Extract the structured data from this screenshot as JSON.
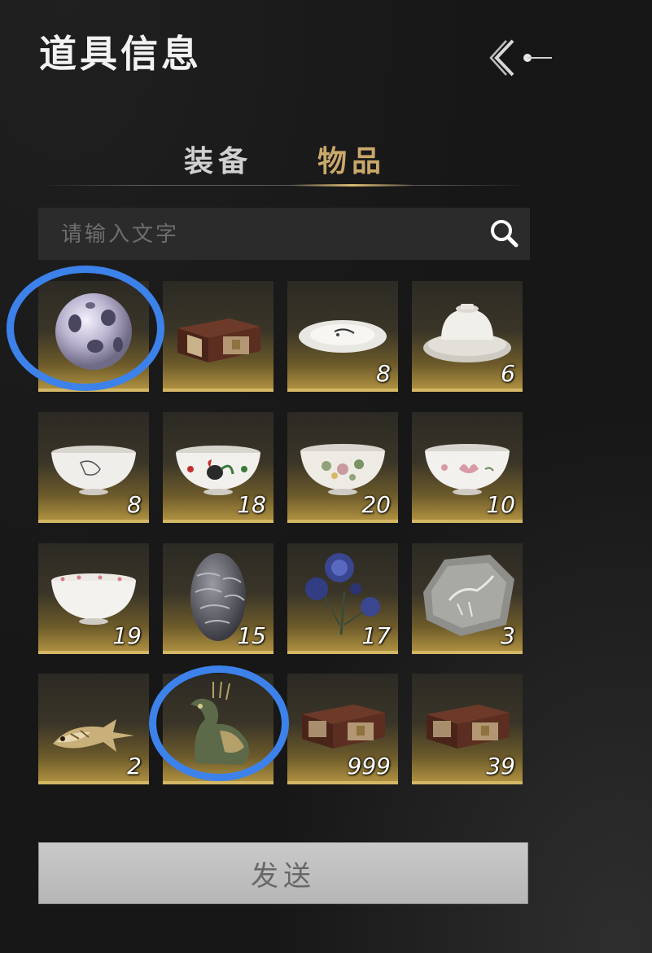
{
  "header": {
    "title": "道具信息",
    "back_icon": "back-arrow-icon"
  },
  "tabs": [
    {
      "label": "装备",
      "active": false
    },
    {
      "label": "物品",
      "active": true
    }
  ],
  "colors": {
    "accent": "#c9a86a",
    "highlight_ring": "#3d82ea"
  },
  "search": {
    "placeholder": "请输入文字",
    "value": "",
    "icon": "search-icon"
  },
  "items": [
    {
      "icon": "pearl-sphere-icon",
      "qty": ""
    },
    {
      "icon": "lacquer-chest-icon",
      "qty": ""
    },
    {
      "icon": "porcelain-plate-icon",
      "qty": "8"
    },
    {
      "icon": "covered-bowl-icon",
      "qty": "6"
    },
    {
      "icon": "ink-painted-bowl-icon",
      "qty": "8"
    },
    {
      "icon": "rooster-bowl-icon",
      "qty": "18"
    },
    {
      "icon": "flower-bowl-icon",
      "qty": "20"
    },
    {
      "icon": "lotus-bowl-icon",
      "qty": "10"
    },
    {
      "icon": "plum-blossom-bowl-icon",
      "qty": "19"
    },
    {
      "icon": "scaled-egg-icon",
      "qty": "15"
    },
    {
      "icon": "blue-flower-icon",
      "qty": "17"
    },
    {
      "icon": "fossil-stone-icon",
      "qty": "3"
    },
    {
      "icon": "koi-fish-icon",
      "qty": "2"
    },
    {
      "icon": "bronze-bird-statue-icon",
      "qty": ""
    },
    {
      "icon": "lacquer-chest-icon",
      "qty": "999"
    },
    {
      "icon": "lacquer-chest-icon",
      "qty": "39"
    }
  ],
  "send_button": {
    "label": "发送"
  }
}
